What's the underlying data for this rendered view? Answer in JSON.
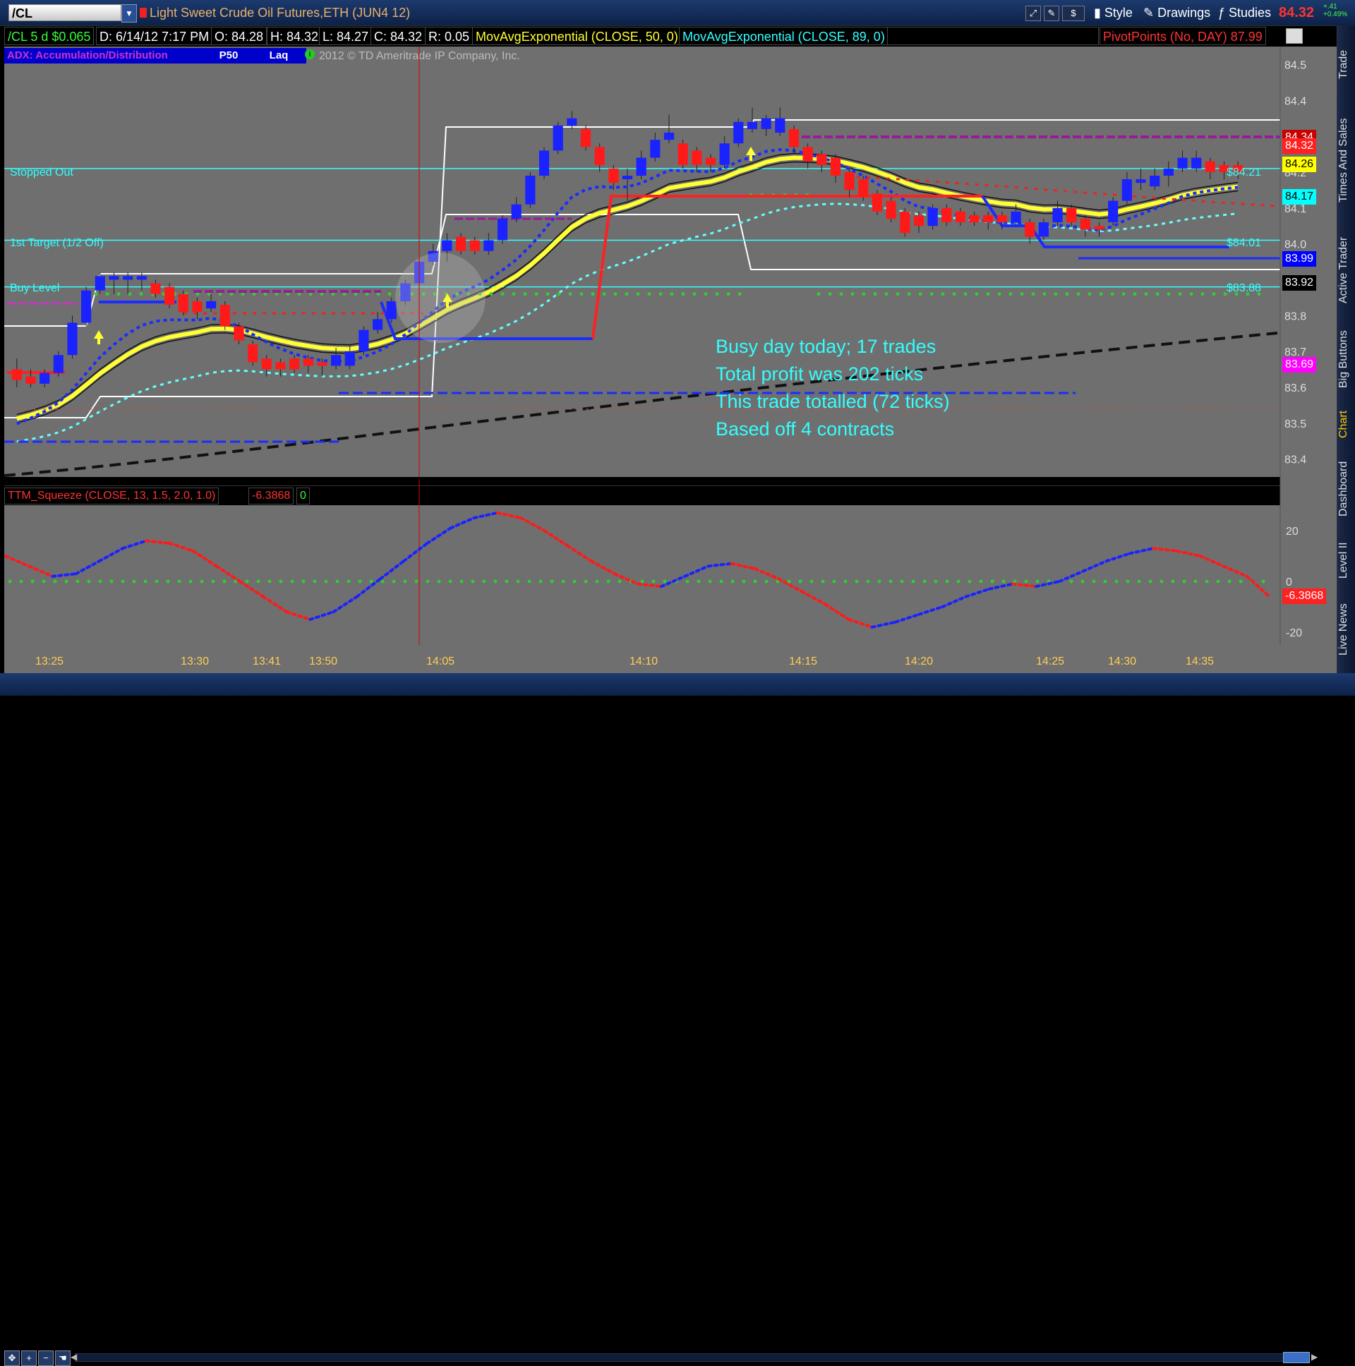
{
  "toolbar": {
    "symbol": "/CL",
    "title": "Light Sweet Crude Oil Futures,ETH (JUN4 12)",
    "style_label": "Style",
    "drawings_label": "Drawings",
    "studies_label": "Studies",
    "last_price": "84.32",
    "change_abs": "+.41",
    "change_pct": "+0.49%",
    "icons": [
      "link-icon",
      "pencil-icon",
      "dollar-icon"
    ]
  },
  "info_bar": {
    "timeframe": "/CL 5 d $0.065",
    "date": "D: 6/14/12 7:17 PM",
    "open": "O: 84.28",
    "high": "H: 84.32",
    "low": "L: 84.27",
    "close": "C: 84.32",
    "range": "R: 0.05",
    "ema50": "MovAvgExponential (CLOSE, 50, 0)",
    "ema89": "MovAvgExponential (CLOSE, 89, 0)",
    "pivot": "PivotPoints (No, DAY)",
    "pivot_value": "87.99"
  },
  "study_tags": {
    "adx": "ADX: Accumulation/Distribution",
    "p50": "P50",
    "laq": "Laq",
    "copyright": "2012 © TD Ameritrade IP Company, Inc."
  },
  "sidebar_tabs": [
    "Trade",
    "Times And Sales",
    "Active Trader",
    "Big Buttons",
    "Chart",
    "Dashboard",
    "Level II",
    "Live News"
  ],
  "annotations": {
    "stopped_out": "Stopped Out",
    "first_target": "1st Target (1/2 Off)",
    "buy_level": "Buy Level",
    "note_lines": [
      "Busy day today; 17 trades",
      "Total profit was 202 ticks",
      "This trade totalled (72 ticks)",
      "Based off 4 contracts"
    ],
    "level_labels": [
      "$84.21",
      "$84.01",
      "$83.88"
    ]
  },
  "price_tags": [
    {
      "label": "84.34",
      "bg": "#c80000",
      "fg": "#ffffff"
    },
    {
      "label": "84.32",
      "bg": "#ff2020",
      "fg": "#ffffff"
    },
    {
      "label": "84.26",
      "bg": "#ffff00",
      "fg": "#000000"
    },
    {
      "label": "84.17",
      "bg": "#00ffff",
      "fg": "#000000"
    },
    {
      "label": "83.99",
      "bg": "#0000ff",
      "fg": "#ffffff"
    },
    {
      "label": "83.92",
      "bg": "#000000",
      "fg": "#ffffff"
    },
    {
      "label": "83.69",
      "bg": "#ff00ff",
      "fg": "#ffffff"
    }
  ],
  "lower_study": {
    "name": "TTM_Squeeze (CLOSE, 13, 1.5, 2.0, 1.0)",
    "value": "-6.3868",
    "value2": "0",
    "tag": "-6.3868"
  },
  "chart_data": {
    "type": "line",
    "title": "Light Sweet Crude Oil Futures,ETH (JUN4 12)",
    "price_axis": {
      "ylim": [
        83.35,
        84.55
      ],
      "ticks": [
        83.4,
        83.5,
        83.6,
        83.7,
        83.8,
        83.9,
        84.0,
        84.1,
        84.2,
        84.3,
        84.4,
        84.5
      ]
    },
    "squeeze_axis": {
      "ylim": [
        -25,
        30
      ],
      "ticks": [
        20,
        0,
        -20
      ]
    },
    "x_tick_labels": [
      "13:25",
      "13:30",
      "13:41",
      "13:50",
      "14:05",
      "14:10",
      "14:15",
      "14:20",
      "14:25",
      "14:30",
      "14:35"
    ],
    "candles": [
      {
        "o": 83.65,
        "h": 83.68,
        "l": 83.6,
        "c": 83.62,
        "col": "red"
      },
      {
        "o": 83.63,
        "h": 83.65,
        "l": 83.6,
        "c": 83.61,
        "col": "red"
      },
      {
        "o": 83.61,
        "h": 83.65,
        "l": 83.6,
        "c": 83.64,
        "col": "blue"
      },
      {
        "o": 83.64,
        "h": 83.7,
        "l": 83.63,
        "c": 83.69,
        "col": "blue"
      },
      {
        "o": 83.69,
        "h": 83.8,
        "l": 83.68,
        "c": 83.78,
        "col": "blue"
      },
      {
        "o": 83.78,
        "h": 83.88,
        "l": 83.77,
        "c": 83.87,
        "col": "blue"
      },
      {
        "o": 83.87,
        "h": 83.92,
        "l": 83.86,
        "c": 83.91,
        "col": "blue"
      },
      {
        "o": 83.91,
        "h": 83.92,
        "l": 83.86,
        "c": 83.9,
        "col": "blue"
      },
      {
        "o": 83.9,
        "h": 83.92,
        "l": 83.86,
        "c": 83.91,
        "col": "blue"
      },
      {
        "o": 83.91,
        "h": 83.92,
        "l": 83.87,
        "c": 83.9,
        "col": "blue"
      },
      {
        "o": 83.89,
        "h": 83.9,
        "l": 83.85,
        "c": 83.86,
        "col": "red"
      },
      {
        "o": 83.88,
        "h": 83.89,
        "l": 83.82,
        "c": 83.83,
        "col": "red"
      },
      {
        "o": 83.86,
        "h": 83.87,
        "l": 83.8,
        "c": 83.81,
        "col": "red"
      },
      {
        "o": 83.84,
        "h": 83.85,
        "l": 83.79,
        "c": 83.81,
        "col": "red"
      },
      {
        "o": 83.82,
        "h": 83.86,
        "l": 83.81,
        "c": 83.84,
        "col": "blue"
      },
      {
        "o": 83.83,
        "h": 83.84,
        "l": 83.76,
        "c": 83.77,
        "col": "red"
      },
      {
        "o": 83.77,
        "h": 83.78,
        "l": 83.72,
        "c": 83.73,
        "col": "red"
      },
      {
        "o": 83.72,
        "h": 83.73,
        "l": 83.66,
        "c": 83.67,
        "col": "red"
      },
      {
        "o": 83.68,
        "h": 83.69,
        "l": 83.63,
        "c": 83.65,
        "col": "red"
      },
      {
        "o": 83.67,
        "h": 83.68,
        "l": 83.63,
        "c": 83.65,
        "col": "red"
      },
      {
        "o": 83.68,
        "h": 83.69,
        "l": 83.64,
        "c": 83.65,
        "col": "red"
      },
      {
        "o": 83.68,
        "h": 83.69,
        "l": 83.64,
        "c": 83.66,
        "col": "red"
      },
      {
        "o": 83.67,
        "h": 83.68,
        "l": 83.63,
        "c": 83.66,
        "col": "red"
      },
      {
        "o": 83.66,
        "h": 83.71,
        "l": 83.65,
        "c": 83.69,
        "col": "blue"
      },
      {
        "o": 83.66,
        "h": 83.72,
        "l": 83.65,
        "c": 83.7,
        "col": "blue"
      },
      {
        "o": 83.7,
        "h": 83.77,
        "l": 83.69,
        "c": 83.76,
        "col": "blue"
      },
      {
        "o": 83.76,
        "h": 83.81,
        "l": 83.75,
        "c": 83.79,
        "col": "blue"
      },
      {
        "o": 83.79,
        "h": 83.85,
        "l": 83.78,
        "c": 83.84,
        "col": "blue"
      },
      {
        "o": 83.84,
        "h": 83.9,
        "l": 83.83,
        "c": 83.89,
        "col": "blue"
      },
      {
        "o": 83.89,
        "h": 83.96,
        "l": 83.88,
        "c": 83.95,
        "col": "blue"
      },
      {
        "o": 83.95,
        "h": 84.0,
        "l": 83.94,
        "c": 83.98,
        "col": "blue"
      },
      {
        "o": 83.98,
        "h": 84.03,
        "l": 83.95,
        "c": 84.01,
        "col": "blue"
      },
      {
        "o": 84.02,
        "h": 84.03,
        "l": 83.97,
        "c": 83.98,
        "col": "red"
      },
      {
        "o": 84.01,
        "h": 84.02,
        "l": 83.97,
        "c": 83.98,
        "col": "red"
      },
      {
        "o": 83.98,
        "h": 84.03,
        "l": 83.97,
        "c": 84.01,
        "col": "blue"
      },
      {
        "o": 84.01,
        "h": 84.08,
        "l": 84.0,
        "c": 84.07,
        "col": "blue"
      },
      {
        "o": 84.07,
        "h": 84.13,
        "l": 84.06,
        "c": 84.11,
        "col": "blue"
      },
      {
        "o": 84.11,
        "h": 84.2,
        "l": 84.1,
        "c": 84.19,
        "col": "blue"
      },
      {
        "o": 84.19,
        "h": 84.27,
        "l": 84.18,
        "c": 84.26,
        "col": "blue"
      },
      {
        "o": 84.26,
        "h": 84.34,
        "l": 84.25,
        "c": 84.33,
        "col": "blue"
      },
      {
        "o": 84.33,
        "h": 84.37,
        "l": 84.32,
        "c": 84.35,
        "col": "blue"
      },
      {
        "o": 84.32,
        "h": 84.33,
        "l": 84.26,
        "c": 84.27,
        "col": "red"
      },
      {
        "o": 84.27,
        "h": 84.28,
        "l": 84.2,
        "c": 84.22,
        "col": "red"
      },
      {
        "o": 84.21,
        "h": 84.22,
        "l": 84.15,
        "c": 84.17,
        "col": "red"
      },
      {
        "o": 84.18,
        "h": 84.21,
        "l": 84.12,
        "c": 84.19,
        "col": "blue"
      },
      {
        "o": 84.19,
        "h": 84.26,
        "l": 84.18,
        "c": 84.24,
        "col": "blue"
      },
      {
        "o": 84.24,
        "h": 84.31,
        "l": 84.23,
        "c": 84.29,
        "col": "blue"
      },
      {
        "o": 84.29,
        "h": 84.36,
        "l": 84.28,
        "c": 84.31,
        "col": "blue"
      },
      {
        "o": 84.28,
        "h": 84.29,
        "l": 84.21,
        "c": 84.22,
        "col": "red"
      },
      {
        "o": 84.26,
        "h": 84.27,
        "l": 84.2,
        "c": 84.22,
        "col": "red"
      },
      {
        "o": 84.24,
        "h": 84.25,
        "l": 84.2,
        "c": 84.22,
        "col": "red"
      },
      {
        "o": 84.22,
        "h": 84.3,
        "l": 84.21,
        "c": 84.28,
        "col": "blue"
      },
      {
        "o": 84.28,
        "h": 84.35,
        "l": 84.27,
        "c": 84.34,
        "col": "blue"
      },
      {
        "o": 84.34,
        "h": 84.38,
        "l": 84.31,
        "c": 84.32,
        "col": "blue"
      },
      {
        "o": 84.32,
        "h": 84.36,
        "l": 84.3,
        "c": 84.35,
        "col": "blue"
      },
      {
        "o": 84.35,
        "h": 84.38,
        "l": 84.3,
        "c": 84.31,
        "col": "blue"
      },
      {
        "o": 84.32,
        "h": 84.33,
        "l": 84.25,
        "c": 84.27,
        "col": "red"
      },
      {
        "o": 84.27,
        "h": 84.28,
        "l": 84.21,
        "c": 84.23,
        "col": "red"
      },
      {
        "o": 84.25,
        "h": 84.26,
        "l": 84.2,
        "c": 84.22,
        "col": "red"
      },
      {
        "o": 84.24,
        "h": 84.25,
        "l": 84.17,
        "c": 84.19,
        "col": "red"
      },
      {
        "o": 84.2,
        "h": 84.21,
        "l": 84.13,
        "c": 84.15,
        "col": "red"
      },
      {
        "o": 84.18,
        "h": 84.19,
        "l": 84.12,
        "c": 84.13,
        "col": "red"
      },
      {
        "o": 84.14,
        "h": 84.15,
        "l": 84.08,
        "c": 84.09,
        "col": "red"
      },
      {
        "o": 84.12,
        "h": 84.13,
        "l": 84.06,
        "c": 84.07,
        "col": "red"
      },
      {
        "o": 84.09,
        "h": 84.1,
        "l": 84.02,
        "c": 84.03,
        "col": "red"
      },
      {
        "o": 84.08,
        "h": 84.09,
        "l": 84.03,
        "c": 84.05,
        "col": "red"
      },
      {
        "o": 84.05,
        "h": 84.11,
        "l": 84.04,
        "c": 84.1,
        "col": "blue"
      },
      {
        "o": 84.1,
        "h": 84.11,
        "l": 84.05,
        "c": 84.06,
        "col": "red"
      },
      {
        "o": 84.09,
        "h": 84.1,
        "l": 84.05,
        "c": 84.06,
        "col": "red"
      },
      {
        "o": 84.08,
        "h": 84.09,
        "l": 84.05,
        "c": 84.06,
        "col": "red"
      },
      {
        "o": 84.08,
        "h": 84.09,
        "l": 84.04,
        "c": 84.06,
        "col": "red"
      },
      {
        "o": 84.08,
        "h": 84.09,
        "l": 84.04,
        "c": 84.06,
        "col": "red"
      },
      {
        "o": 84.06,
        "h": 84.11,
        "l": 84.05,
        "c": 84.09,
        "col": "blue"
      },
      {
        "o": 84.06,
        "h": 84.07,
        "l": 84.0,
        "c": 84.02,
        "col": "red"
      },
      {
        "o": 84.02,
        "h": 84.07,
        "l": 84.01,
        "c": 84.06,
        "col": "blue"
      },
      {
        "o": 84.06,
        "h": 84.12,
        "l": 84.05,
        "c": 84.1,
        "col": "blue"
      },
      {
        "o": 84.1,
        "h": 84.11,
        "l": 84.05,
        "c": 84.06,
        "col": "red"
      },
      {
        "o": 84.07,
        "h": 84.08,
        "l": 84.02,
        "c": 84.04,
        "col": "red"
      },
      {
        "o": 84.05,
        "h": 84.06,
        "l": 84.02,
        "c": 84.04,
        "col": "red"
      },
      {
        "o": 84.06,
        "h": 84.13,
        "l": 84.05,
        "c": 84.12,
        "col": "blue"
      },
      {
        "o": 84.12,
        "h": 84.2,
        "l": 84.11,
        "c": 84.18,
        "col": "blue"
      },
      {
        "o": 84.18,
        "h": 84.21,
        "l": 84.15,
        "c": 84.17,
        "col": "blue"
      },
      {
        "o": 84.16,
        "h": 84.21,
        "l": 84.15,
        "c": 84.19,
        "col": "blue"
      },
      {
        "o": 84.19,
        "h": 84.23,
        "l": 84.16,
        "c": 84.21,
        "col": "blue"
      },
      {
        "o": 84.21,
        "h": 84.26,
        "l": 84.2,
        "c": 84.24,
        "col": "blue"
      },
      {
        "o": 84.24,
        "h": 84.26,
        "l": 84.2,
        "c": 84.21,
        "col": "blue"
      },
      {
        "o": 84.23,
        "h": 84.24,
        "l": 84.18,
        "c": 84.2,
        "col": "red"
      },
      {
        "o": 84.22,
        "h": 84.23,
        "l": 84.18,
        "c": 84.2,
        "col": "red"
      },
      {
        "o": 84.22,
        "h": 84.23,
        "l": 84.18,
        "c": 84.2,
        "col": "red"
      }
    ],
    "series": [
      {
        "name": "MovAvgExponential (CLOSE, 50, 0)",
        "color": "#ffff33"
      },
      {
        "name": "MovAvgExponential (CLOSE, 89, 0)",
        "color": "#33ffff"
      }
    ],
    "horizontal_levels": [
      84.21,
      84.01,
      83.88
    ],
    "squeeze_values": [
      10,
      6,
      2,
      3,
      8,
      13,
      16,
      15,
      12,
      6,
      0,
      -6,
      -12,
      -15,
      -12,
      -6,
      1,
      8,
      15,
      21,
      25,
      27,
      25,
      20,
      14,
      8,
      3,
      -1,
      -2,
      2,
      6,
      7,
      5,
      1,
      -4,
      -9,
      -15,
      -18,
      -16,
      -13,
      -10,
      -6,
      -3,
      -1,
      -2,
      0,
      4,
      8,
      11,
      13,
      12,
      10,
      6,
      2,
      -6.3868
    ]
  }
}
